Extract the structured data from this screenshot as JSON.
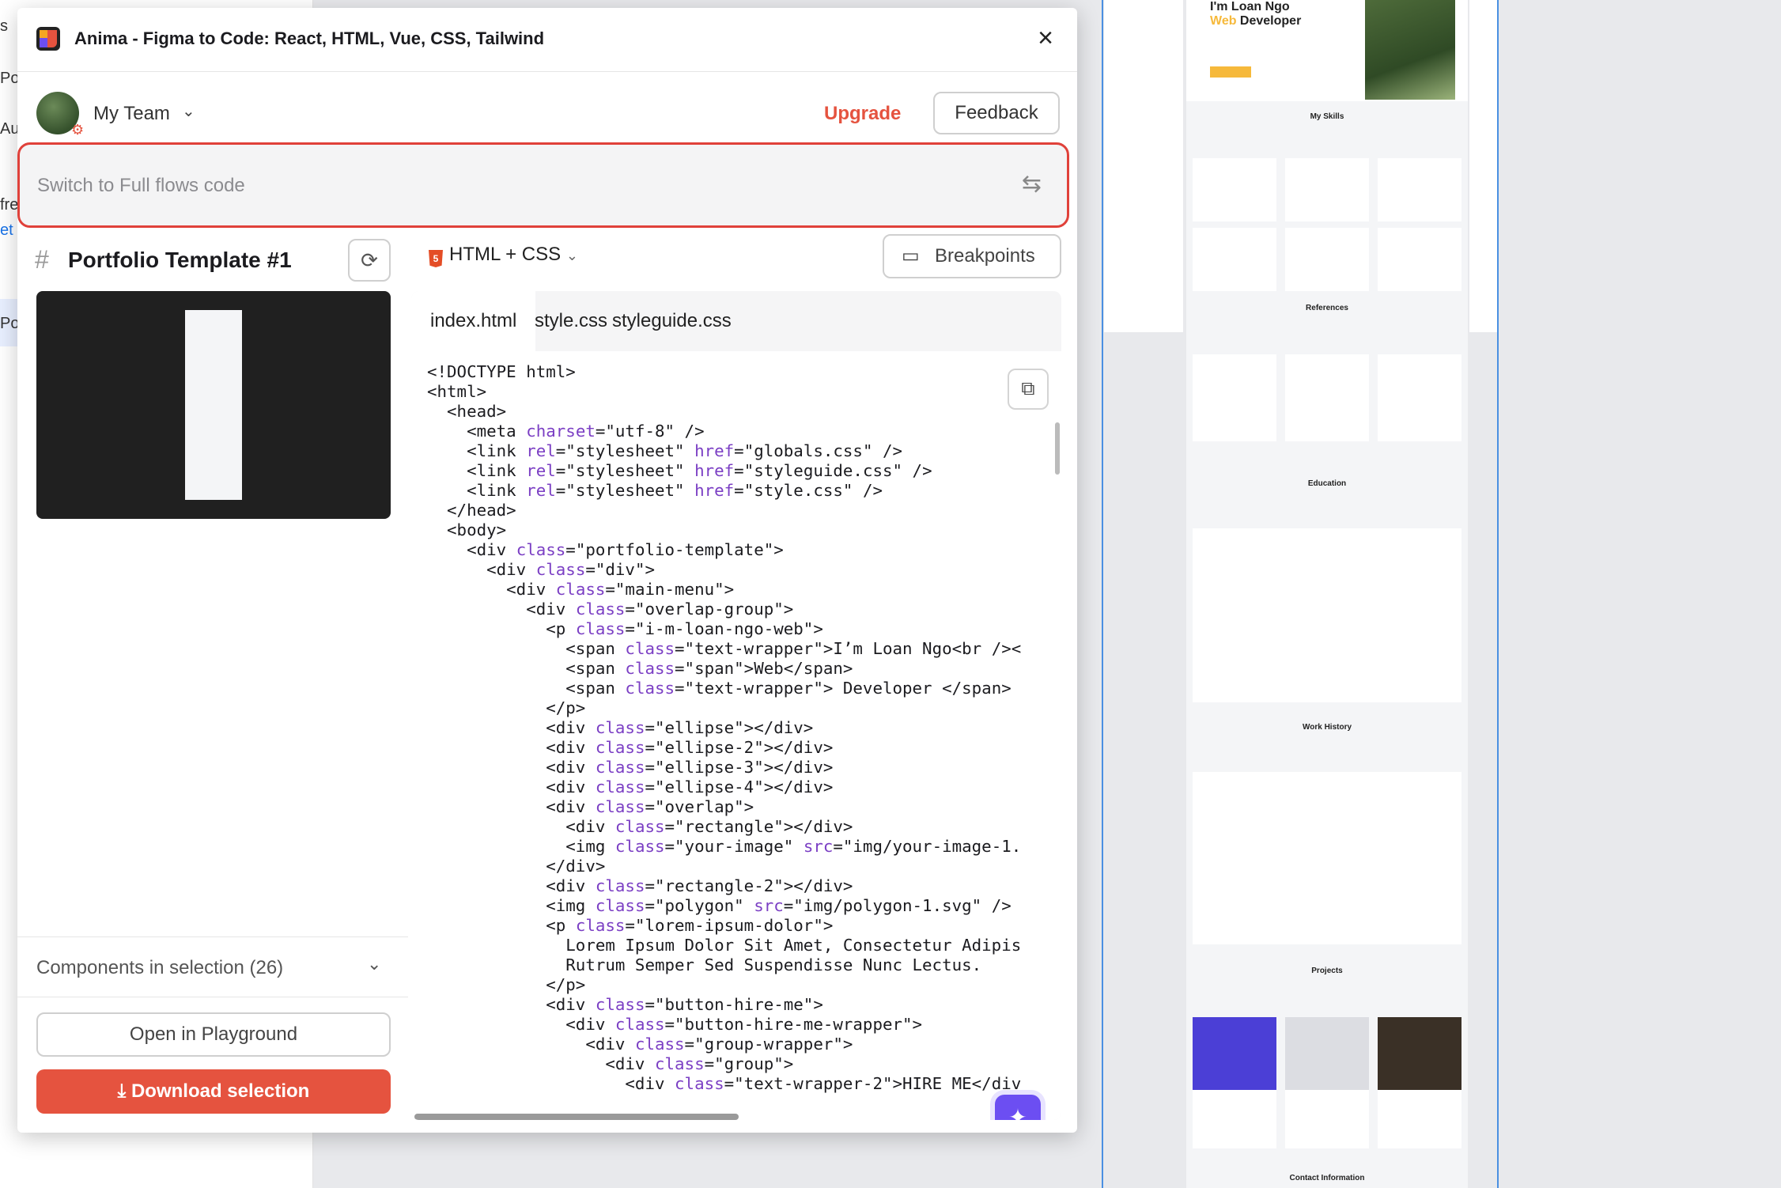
{
  "plugin": {
    "title": "Anima - Figma to Code: React, HTML, Vue, CSS, Tailwind",
    "close_icon": "×",
    "team_label": "My Team",
    "team_chevron": "⌄",
    "upgrade_label": "Upgrade",
    "feedback_label": "Feedback",
    "switch_placeholder": "Switch to Full flows code",
    "switch_icon": "⇆",
    "frame_hash": "#",
    "frame_name": "Portfolio Template #1",
    "refresh_icon": "⟳",
    "lang_label": "HTML + CSS",
    "lang_chevron": "⌄",
    "breakpoints_label": "Breakpoints",
    "breakpoints_icon": "▭",
    "tabs": [
      "index.html",
      "style.css",
      "styleguide.css"
    ],
    "copy_icon": "⧉",
    "ai_icon": "✦",
    "components_label": "Components in selection (26)",
    "components_chevron": "⌄",
    "open_playground_label": "Open in Playground",
    "download_label": "Download selection",
    "download_icon": "⤓",
    "accent_color": "#e5533f",
    "ai_color": "#6c4ef2"
  },
  "code_lines": [
    "<!DOCTYPE html>",
    "<html>",
    "  <head>",
    "    <meta charset=\"utf-8\" />",
    "    <link rel=\"stylesheet\" href=\"globals.css\" />",
    "    <link rel=\"stylesheet\" href=\"styleguide.css\" />",
    "    <link rel=\"stylesheet\" href=\"style.css\" />",
    "  </head>",
    "  <body>",
    "    <div class=\"portfolio-template\">",
    "      <div class=\"div\">",
    "        <div class=\"main-menu\">",
    "          <div class=\"overlap-group\">",
    "            <p class=\"i-m-loan-ngo-web\">",
    "              <span class=\"text-wrapper\">I’m Loan Ngo<br /><",
    "              <span class=\"span\">Web</span>",
    "              <span class=\"text-wrapper\"> Developer </span>",
    "            </p>",
    "            <div class=\"ellipse\"></div>",
    "            <div class=\"ellipse-2\"></div>",
    "            <div class=\"ellipse-3\"></div>",
    "            <div class=\"ellipse-4\"></div>",
    "            <div class=\"overlap\">",
    "              <div class=\"rectangle\"></div>",
    "              <img class=\"your-image\" src=\"img/your-image-1.",
    "            </div>",
    "            <div class=\"rectangle-2\"></div>",
    "            <img class=\"polygon\" src=\"img/polygon-1.svg\" />",
    "            <p class=\"lorem-ipsum-dolor\">",
    "              Lorem Ipsum Dolor Sit Amet, Consectetur Adipis",
    "              Rutrum Semper Sed Suspendisse Nunc Lectus.",
    "            </p>",
    "            <div class=\"button-hire-me\">",
    "              <div class=\"button-hire-me-wrapper\">",
    "                <div class=\"group-wrapper\">",
    "                  <div class=\"group\">",
    "                    <div class=\"text-wrapper-2\">HIRE ME</div"
  ],
  "background": {
    "left_fragments": [
      "s",
      "Po",
      "Au",
      "fre",
      "et",
      "Po"
    ],
    "canvas": {
      "hero_line1": "I'm Loan Ngo",
      "hero_line2_accent": "Web",
      "hero_line2_rest": " Developer",
      "sections": [
        "My Skills",
        "References",
        "Education",
        "Work History",
        "Projects",
        "Contact Information"
      ]
    }
  }
}
